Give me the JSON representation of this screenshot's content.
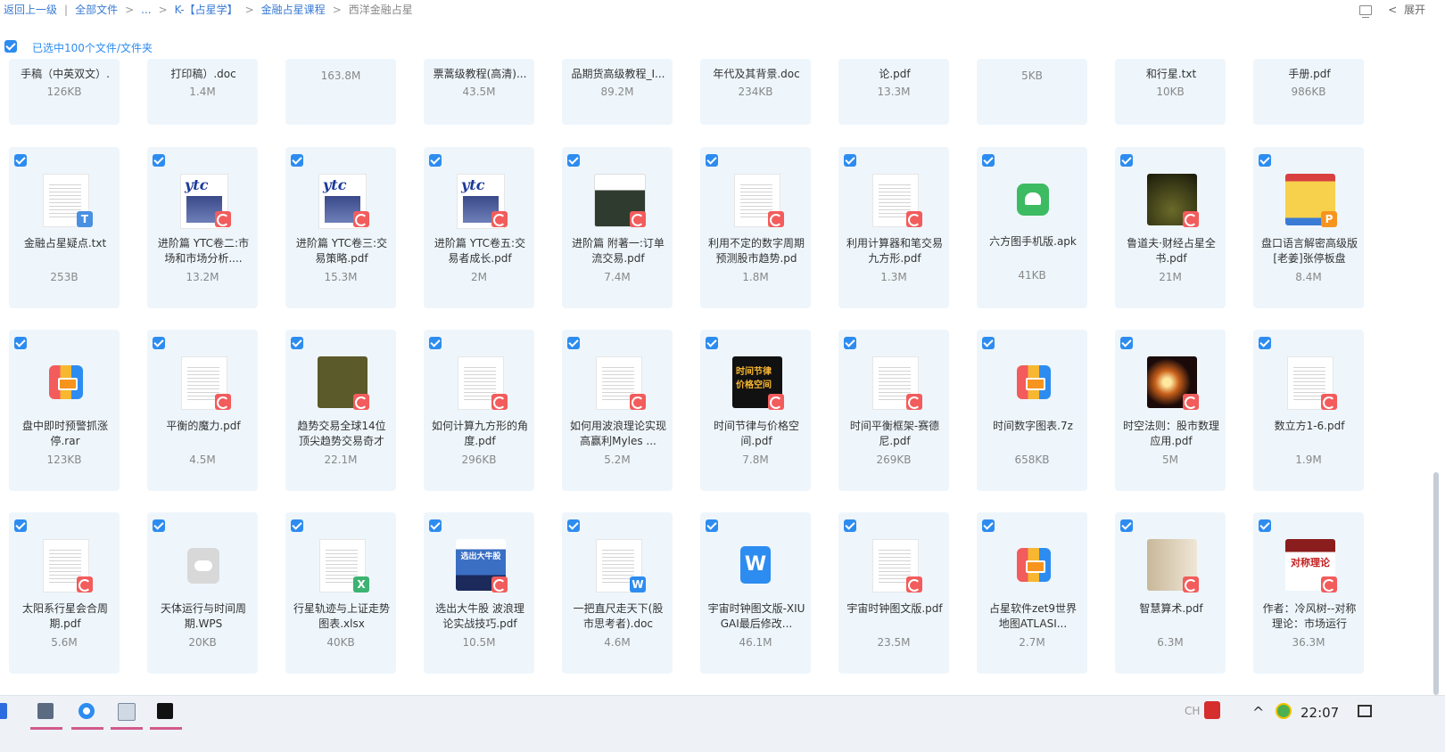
{
  "breadcrumb": {
    "back": "返回上一级",
    "all_files": "全部文件",
    "ellipsis": "...",
    "folder1": "K-【占星学】",
    "folder2": "金融占星课程",
    "current": "西洋金融占星"
  },
  "topright": {
    "expand": "展开",
    "chevron": "<"
  },
  "selection": {
    "label": "已选中100个文件/文件夹"
  },
  "rows": [
    {
      "top": [
        {
          "name": "手稿（中英双文）.",
          "size": "126KB"
        },
        {
          "name": "打印稿）.doc",
          "size": "1.4M"
        },
        {
          "name": "",
          "size": "163.8M"
        },
        {
          "name": "票蒿级教程(高清)...",
          "size": "43.5M"
        },
        {
          "name": "品期货高级教程_I...",
          "size": "89.2M"
        },
        {
          "name": "年代及其背景.doc",
          "size": "234KB"
        },
        {
          "name": "论.pdf",
          "size": "13.3M"
        },
        {
          "name": "",
          "size": "5KB"
        },
        {
          "name": "和行星.txt",
          "size": "10KB"
        },
        {
          "name": "手册.pdf",
          "size": "986KB"
        }
      ]
    }
  ],
  "files_row1": [
    {
      "name": "金融占星疑点.txt",
      "size": "253B",
      "icon": "txt-file-icon"
    },
    {
      "name": "进阶篇 YTC卷二:市场和市场分析....",
      "size": "13.2M",
      "icon": "pdf-file-icon"
    },
    {
      "name": "进阶篇 YTC卷三:交易策略.pdf",
      "size": "15.3M",
      "icon": "pdf-file-icon"
    },
    {
      "name": "进阶篇 YTC卷五:交易者成长.pdf",
      "size": "2M",
      "icon": "pdf-file-icon"
    },
    {
      "name": "进阶篇 附著一:订单流交易.pdf",
      "size": "7.4M",
      "icon": "pdf-file-icon"
    },
    {
      "name": "利用不定的数字周期预测股市趋势.pd",
      "size": "1.8M",
      "icon": "pdf-file-icon"
    },
    {
      "name": "利用计算器和笔交易九方形.pdf",
      "size": "1.3M",
      "icon": "pdf-file-icon"
    },
    {
      "name": "六方图手机版.apk",
      "size": "41KB",
      "icon": "apk-file-icon"
    },
    {
      "name": "鲁道夫·财经占星全书.pdf",
      "size": "21M",
      "icon": "pdf-file-icon"
    },
    {
      "name": "盘口语言解密高级版[老姜]张停板盘",
      "size": "8.4M",
      "icon": "ppt-file-icon"
    }
  ],
  "files_row2": [
    {
      "name": "盘中即时预警抓涨停.rar",
      "size": "123KB",
      "icon": "rar-file-icon"
    },
    {
      "name": "平衡的魔力.pdf",
      "size": "4.5M",
      "icon": "pdf-file-icon"
    },
    {
      "name": "趋势交易全球14位顶尖趋势交易奇才",
      "size": "22.1M",
      "icon": "pdf-file-icon"
    },
    {
      "name": "如何计算九方形的角度.pdf",
      "size": "296KB",
      "icon": "pdf-file-icon"
    },
    {
      "name": "如何用波浪理论实现高赢利Myles ...",
      "size": "5.2M",
      "icon": "pdf-file-icon"
    },
    {
      "name": "时间节律与价格空间.pdf",
      "size": "7.8M",
      "icon": "pdf-file-icon"
    },
    {
      "name": "时间平衡框架-赛德尼.pdf",
      "size": "269KB",
      "icon": "pdf-file-icon"
    },
    {
      "name": "时间数字图表.7z",
      "size": "658KB",
      "icon": "zip-file-icon"
    },
    {
      "name": "时空法则：股市数理应用.pdf",
      "size": "5M",
      "icon": "pdf-file-icon"
    },
    {
      "name": "数立方1-6.pdf",
      "size": "1.9M",
      "icon": "pdf-file-icon"
    }
  ],
  "files_row3": [
    {
      "name": "太阳系行星会合周期.pdf",
      "size": "5.6M",
      "icon": "pdf-file-icon"
    },
    {
      "name": "天体运行与时间周期.WPS",
      "size": "20KB",
      "icon": "wps-file-icon"
    },
    {
      "name": "行星轨迹与上证走势图表.xlsx",
      "size": "40KB",
      "icon": "xlsx-file-icon"
    },
    {
      "name": "选出大牛股 波浪理论实战技巧.pdf",
      "size": "10.5M",
      "icon": "pdf-file-icon"
    },
    {
      "name": "一把直尺走天下(股市思考者).doc",
      "size": "4.6M",
      "icon": "doc-file-icon"
    },
    {
      "name": "宇宙时钟图文版-XIUGAI最后修改...",
      "size": "46.1M",
      "icon": "word-file-icon"
    },
    {
      "name": "宇宙时钟图文版.pdf",
      "size": "23.5M",
      "icon": "pdf-file-icon"
    },
    {
      "name": "占星软件zet9世界地图ATLASI...",
      "size": "2.7M",
      "icon": "zip-file-icon"
    },
    {
      "name": "智慧算术.pdf",
      "size": "6.3M",
      "icon": "pdf-file-icon"
    },
    {
      "name": "作者：冷风树--对称理论：市场运行",
      "size": "36.3M",
      "icon": "pdf-file-icon"
    }
  ],
  "thumb_text": {
    "ytc": "ytc",
    "cover_time": "时间节律价格空间",
    "cover_symmetry": "对称理论",
    "cover_bull": "选出大牛股"
  },
  "taskbar": {
    "lang": "CH",
    "clock": "22:07",
    "chevron": "^"
  },
  "colors": {
    "accent": "#2d8cf0",
    "card_bg": "#eef6fc",
    "pdf_red": "#f25c5c"
  }
}
